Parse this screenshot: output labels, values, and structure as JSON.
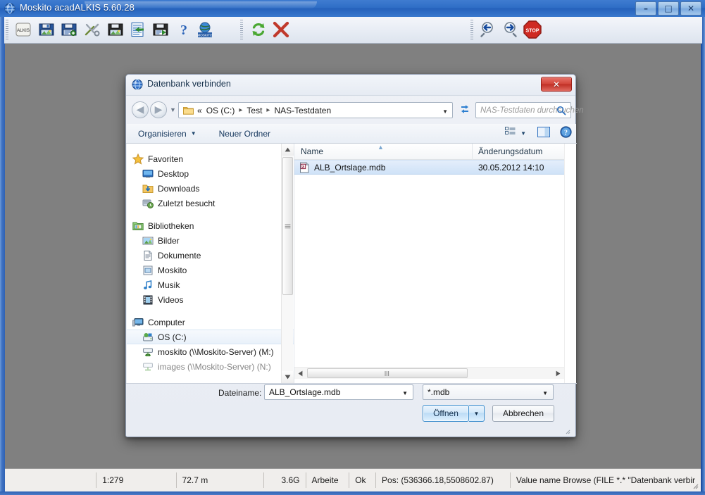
{
  "app": {
    "title": "Moskito acadALKIS 5.60.28",
    "icon": "globe-icon",
    "window_buttons": [
      {
        "name": "minimize",
        "glyph": "–"
      },
      {
        "name": "maximize",
        "glyph": "□"
      },
      {
        "name": "close",
        "glyph": "✕"
      }
    ],
    "toolbar": {
      "items": [
        {
          "name": "alkis-button",
          "icon": "alkis-icon",
          "label": "ALKIS"
        },
        {
          "name": "open-image-button",
          "icon": "floppy-image-icon",
          "label": ""
        },
        {
          "name": "save-data-button",
          "icon": "floppy-data-icon",
          "label": ""
        },
        {
          "name": "tools-button",
          "icon": "tools-icon",
          "label": ""
        },
        {
          "name": "import-image-button",
          "icon": "floppy-image2-icon",
          "label": ""
        },
        {
          "name": "import-document-button",
          "icon": "document-import-icon",
          "label": ""
        },
        {
          "name": "export-document-button",
          "icon": "floppy-document-icon",
          "label": ""
        },
        {
          "name": "help-button",
          "icon": "question-mark-icon",
          "label": ""
        },
        {
          "name": "moskito-web-button",
          "icon": "moskito-globe-icon",
          "label": ""
        },
        {
          "name": "refresh-button",
          "icon": "green-refresh-icon",
          "label": ""
        },
        {
          "name": "delete-button",
          "icon": "red-x-icon",
          "label": ""
        },
        {
          "name": "zoom-out-button",
          "icon": "magnifier-left-icon",
          "label": ""
        },
        {
          "name": "zoom-in-button",
          "icon": "magnifier-right-icon",
          "label": ""
        },
        {
          "name": "stop-button",
          "icon": "stop-sign-icon",
          "label": "STOP"
        }
      ]
    },
    "statusbar": {
      "scale": "1:279",
      "length": "72.7 m",
      "memory": "3.6G",
      "work": "Arbeite",
      "state": "Ok",
      "position": "Pos: (536366.18,5508602.87)",
      "command": "Value name Browse (FILE *.* \"Datenbank verbir"
    }
  },
  "dialog": {
    "title": "Datenbank verbinden",
    "title_icon": "globe-icon",
    "close_glyph": "✕",
    "address": {
      "back_name": "back-button",
      "forward_name": "forward-button",
      "crumbs": [
        "«",
        "OS (C:)",
        "Test",
        "NAS-Testdaten"
      ],
      "separator": "▸",
      "dropdown_glyph": "▼",
      "refresh_icon": "refresh-arrows-icon"
    },
    "search": {
      "placeholder": "NAS-Testdaten durchsuchen",
      "icon": "search-icon"
    },
    "commandbar": {
      "organize_label": "Organisieren",
      "organize_caret": "▼",
      "new_folder_label": "Neuer Ordner",
      "view_icon": "view-list-icon",
      "view_caret": "▼",
      "preview_icon": "preview-pane-icon",
      "help_icon": "help-circle-icon"
    },
    "navigation": {
      "groups": [
        {
          "header": {
            "label": "Favoriten",
            "icon": "star-icon"
          },
          "items": [
            {
              "label": "Desktop",
              "icon": "desktop-icon",
              "selected": false
            },
            {
              "label": "Downloads",
              "icon": "downloads-icon",
              "selected": false
            },
            {
              "label": "Zuletzt besucht",
              "icon": "recent-places-icon",
              "selected": false
            }
          ]
        },
        {
          "header": {
            "label": "Bibliotheken",
            "icon": "libraries-icon"
          },
          "items": [
            {
              "label": "Bilder",
              "icon": "pictures-icon",
              "selected": false
            },
            {
              "label": "Dokumente",
              "icon": "documents-icon",
              "selected": false
            },
            {
              "label": "Moskito",
              "icon": "library-icon",
              "selected": false
            },
            {
              "label": "Musik",
              "icon": "music-icon",
              "selected": false
            },
            {
              "label": "Videos",
              "icon": "videos-icon",
              "selected": false
            }
          ]
        },
        {
          "header": {
            "label": "Computer",
            "icon": "computer-icon"
          },
          "items": [
            {
              "label": "OS (C:)",
              "icon": "harddisk-icon",
              "selected": true
            },
            {
              "label": "moskito (\\\\Moskito-Server) (M:)",
              "icon": "network-drive-icon",
              "selected": false
            },
            {
              "label": "images (\\\\Moskito-Server) (N:)",
              "icon": "network-drive-icon",
              "selected": false
            }
          ]
        }
      ]
    },
    "filelist": {
      "columns": [
        "Name",
        "Änderungsdatum"
      ],
      "sort_caret": "▲",
      "rows": [
        {
          "name": "ALB_Ortslage.mdb",
          "date": "30.05.2012 14:10",
          "icon": "mdb-file-icon",
          "selected": true
        }
      ]
    },
    "footer": {
      "filename_label": "Dateiname:",
      "filename_value": "ALB_Ortslage.mdb",
      "filter_value": "*.mdb",
      "open_label": "Öffnen",
      "open_caret": "▼",
      "cancel_label": "Abbrechen",
      "combo_caret": "▼"
    }
  },
  "colors": {
    "accent_blue": "#2f6ec6",
    "dialog_bg": "#eef1f6",
    "canvas": "#808080",
    "selection": "#cfe2f7",
    "close_red": "#d2453a"
  }
}
